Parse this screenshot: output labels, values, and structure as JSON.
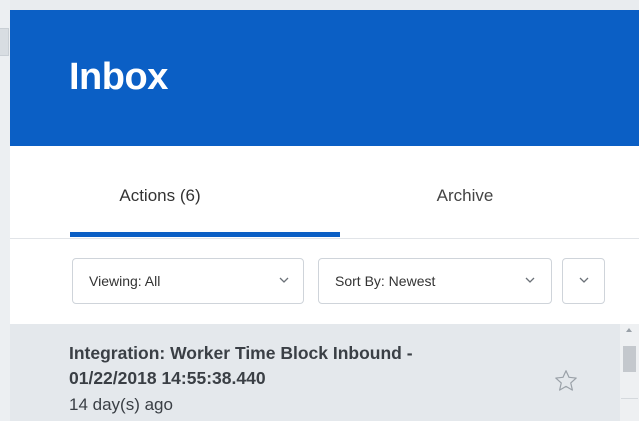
{
  "header": {
    "title": "Inbox",
    "bg_color": "#0b5fc5"
  },
  "tabs": [
    {
      "label": "Actions (6)",
      "active": true
    },
    {
      "label": "Archive",
      "active": false
    }
  ],
  "filters": {
    "viewing": {
      "label": "Viewing: All"
    },
    "sort": {
      "label": "Sort By: Newest"
    },
    "more": {
      "icon": "chevron-down-icon"
    }
  },
  "inbox_items": [
    {
      "title": "Integration: Worker Time Block Inbound - 01/22/2018 14:55:38.440",
      "age": "14 day(s) ago",
      "starred": false
    }
  ],
  "colors": {
    "accent": "#0b5fc5",
    "list_bg": "#e4e8ec"
  }
}
